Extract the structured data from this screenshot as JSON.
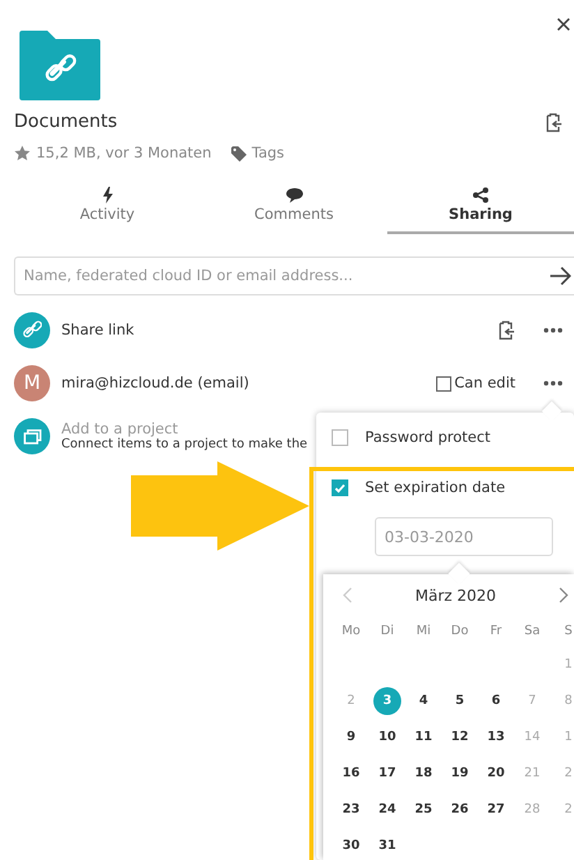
{
  "file": {
    "name": "Documents",
    "meta": "15,2 MB, vor 3 Monaten",
    "tags": "Tags",
    "favorite": false
  },
  "tabs": [
    {
      "label": "Activity",
      "selected": false
    },
    {
      "label": "Comments",
      "selected": false
    },
    {
      "label": "Sharing",
      "selected": true
    }
  ],
  "search": {
    "placeholder": "Name, federated cloud ID or email address..."
  },
  "shares": [
    {
      "kind": "link",
      "label": "Share link"
    },
    {
      "kind": "user",
      "avatar": "M",
      "label": "mira@hizcloud.de (email)",
      "permission": "Can edit",
      "can_edit": false
    },
    {
      "kind": "project",
      "label": "Add to a project",
      "hint": "Connect items to a project to make the"
    }
  ],
  "menu": {
    "options": [
      {
        "label": "Password protect",
        "checked": false
      },
      {
        "label": "Set expiration date",
        "checked": true
      }
    ],
    "date_value": "03-03-2020"
  },
  "calendar": {
    "month": "März 2020",
    "weekdays": [
      "Mo",
      "Di",
      "Mi",
      "Do",
      "Fr",
      "Sa",
      "S"
    ],
    "weeks": [
      [
        {
          "kind": "blank"
        },
        {
          "kind": "blank"
        },
        {
          "kind": "blank"
        },
        {
          "kind": "blank"
        },
        {
          "kind": "blank"
        },
        {
          "kind": "blank"
        },
        {
          "kind": "day",
          "day": "1",
          "muted": true,
          "selected": false
        }
      ],
      [
        {
          "kind": "day",
          "day": "2",
          "muted": true,
          "selected": false
        },
        {
          "kind": "day",
          "day": "3",
          "muted": false,
          "selected": true
        },
        {
          "kind": "day",
          "day": "4",
          "muted": false,
          "selected": false
        },
        {
          "kind": "day",
          "day": "5",
          "muted": false,
          "selected": false
        },
        {
          "kind": "day",
          "day": "6",
          "muted": false,
          "selected": false
        },
        {
          "kind": "day",
          "day": "7",
          "muted": true,
          "selected": false
        },
        {
          "kind": "day",
          "day": "8",
          "muted": true,
          "selected": false
        }
      ],
      [
        {
          "kind": "day",
          "day": "9",
          "muted": false,
          "selected": false
        },
        {
          "kind": "day",
          "day": "10",
          "muted": false,
          "selected": false
        },
        {
          "kind": "day",
          "day": "11",
          "muted": false,
          "selected": false
        },
        {
          "kind": "day",
          "day": "12",
          "muted": false,
          "selected": false
        },
        {
          "kind": "day",
          "day": "13",
          "muted": false,
          "selected": false
        },
        {
          "kind": "day",
          "day": "14",
          "muted": true,
          "selected": false
        },
        {
          "kind": "day",
          "day": "1",
          "muted": true,
          "selected": false
        }
      ],
      [
        {
          "kind": "day",
          "day": "16",
          "muted": false,
          "selected": false
        },
        {
          "kind": "day",
          "day": "17",
          "muted": false,
          "selected": false
        },
        {
          "kind": "day",
          "day": "18",
          "muted": false,
          "selected": false
        },
        {
          "kind": "day",
          "day": "19",
          "muted": false,
          "selected": false
        },
        {
          "kind": "day",
          "day": "20",
          "muted": false,
          "selected": false
        },
        {
          "kind": "day",
          "day": "21",
          "muted": true,
          "selected": false
        },
        {
          "kind": "day",
          "day": "2",
          "muted": true,
          "selected": false
        }
      ],
      [
        {
          "kind": "day",
          "day": "23",
          "muted": false,
          "selected": false
        },
        {
          "kind": "day",
          "day": "24",
          "muted": false,
          "selected": false
        },
        {
          "kind": "day",
          "day": "25",
          "muted": false,
          "selected": false
        },
        {
          "kind": "day",
          "day": "26",
          "muted": false,
          "selected": false
        },
        {
          "kind": "day",
          "day": "27",
          "muted": false,
          "selected": false
        },
        {
          "kind": "day",
          "day": "28",
          "muted": true,
          "selected": false
        },
        {
          "kind": "day",
          "day": "2",
          "muted": true,
          "selected": false
        }
      ],
      [
        {
          "kind": "day",
          "day": "30",
          "muted": false,
          "selected": false
        },
        {
          "kind": "day",
          "day": "31",
          "muted": false,
          "selected": false
        }
      ]
    ]
  }
}
